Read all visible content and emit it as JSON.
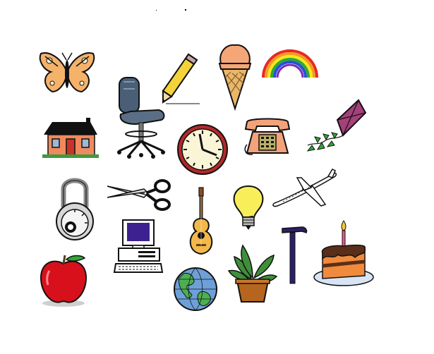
{
  "canvas": {
    "background": "#ffffff"
  },
  "items": [
    {
      "key": "butterfly",
      "icon": "butterfly-icon"
    },
    {
      "key": "office_chair",
      "icon": "office-chair-icon"
    },
    {
      "key": "pencil",
      "icon": "pencil-icon"
    },
    {
      "key": "ice_cream_cone",
      "icon": "ice-cream-cone-icon"
    },
    {
      "key": "rainbow",
      "icon": "rainbow-icon"
    },
    {
      "key": "house",
      "icon": "house-icon"
    },
    {
      "key": "wall_clock",
      "icon": "wall-clock-icon"
    },
    {
      "key": "telephone",
      "icon": "telephone-icon"
    },
    {
      "key": "kite",
      "icon": "kite-icon"
    },
    {
      "key": "combination_lock",
      "icon": "combination-lock-icon"
    },
    {
      "key": "scissors",
      "icon": "scissors-icon"
    },
    {
      "key": "guitar",
      "icon": "guitar-icon"
    },
    {
      "key": "light_bulb",
      "icon": "light-bulb-icon"
    },
    {
      "key": "airplane",
      "icon": "airplane-icon"
    },
    {
      "key": "apple",
      "icon": "apple-icon"
    },
    {
      "key": "computer",
      "icon": "computer-icon"
    },
    {
      "key": "globe",
      "icon": "globe-icon"
    },
    {
      "key": "potted_plant",
      "icon": "potted-plant-icon"
    },
    {
      "key": "hammer",
      "icon": "hammer-icon"
    },
    {
      "key": "birthday_cake",
      "icon": "birthday-cake-icon"
    }
  ]
}
